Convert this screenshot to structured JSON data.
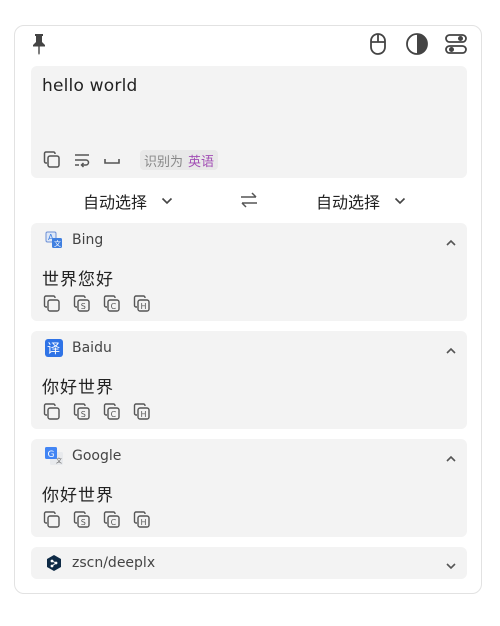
{
  "toolbar": {
    "pin": "pin-icon",
    "mouse": "mouse-icon",
    "theme": "contrast-icon",
    "settings": "toggles-icon"
  },
  "source": {
    "text": "hello world",
    "detect_prefix": "识别为",
    "detect_lang": "英语"
  },
  "langbar": {
    "from": "自动选择",
    "to": "自动选择"
  },
  "services": [
    {
      "name": "Bing",
      "result": "世界您好",
      "expanded": true
    },
    {
      "name": "Baidu",
      "result": "你好世界",
      "expanded": true
    },
    {
      "name": "Google",
      "result": "你好世界",
      "expanded": true
    },
    {
      "name": "zscn/deeplx",
      "result": "",
      "expanded": false
    }
  ],
  "colors": {
    "card_bg": "#f3f3f3",
    "detect_lang": "#a24fb5",
    "baidu_blue": "#2f73e6",
    "bing_blue": "#3f7fe0",
    "google_blue": "#4285f4"
  }
}
